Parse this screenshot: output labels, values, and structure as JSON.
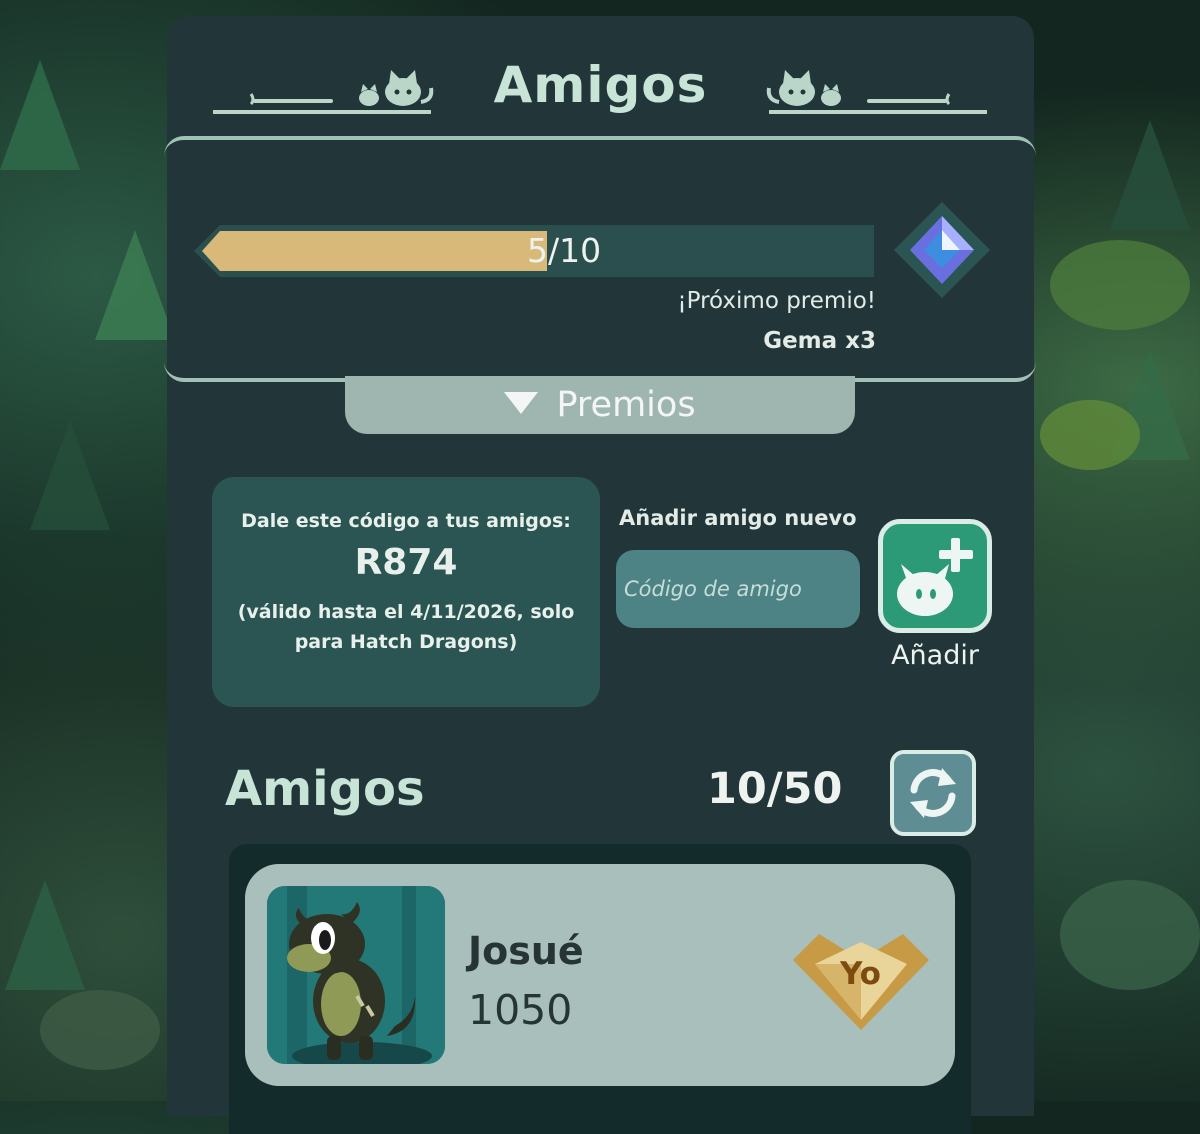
{
  "header": {
    "title": "Amigos"
  },
  "progress": {
    "current": 5,
    "total": 10,
    "fraction": 0.5,
    "label_current": "5",
    "label_total": "/10",
    "next_reward_label": "¡Próximo premio!",
    "next_reward_value": "Gema x3",
    "reward_icon": "gem-icon"
  },
  "premios_button": {
    "label": "Premios"
  },
  "share_code": {
    "intro": "Dale este código a tus amigos:",
    "code": "R874",
    "validity": "(válido hasta el 4/11/2026, solo para Hatch Dragons)"
  },
  "add_friend": {
    "label": "Añadir amigo nuevo",
    "placeholder": "Código de amigo",
    "button_label": "Añadir",
    "button_icon": "cat-plus-icon"
  },
  "friends": {
    "header": "Amigos",
    "count": "10/50",
    "refresh_icon": "refresh-icon",
    "list": [
      {
        "name": "Josué",
        "score": "1050",
        "badge": "Yo"
      }
    ]
  },
  "colors": {
    "panel": "#223538",
    "accent_green": "#2d9a77",
    "progress_fill": "#d9b979",
    "title_text": "#c8e4d6"
  }
}
